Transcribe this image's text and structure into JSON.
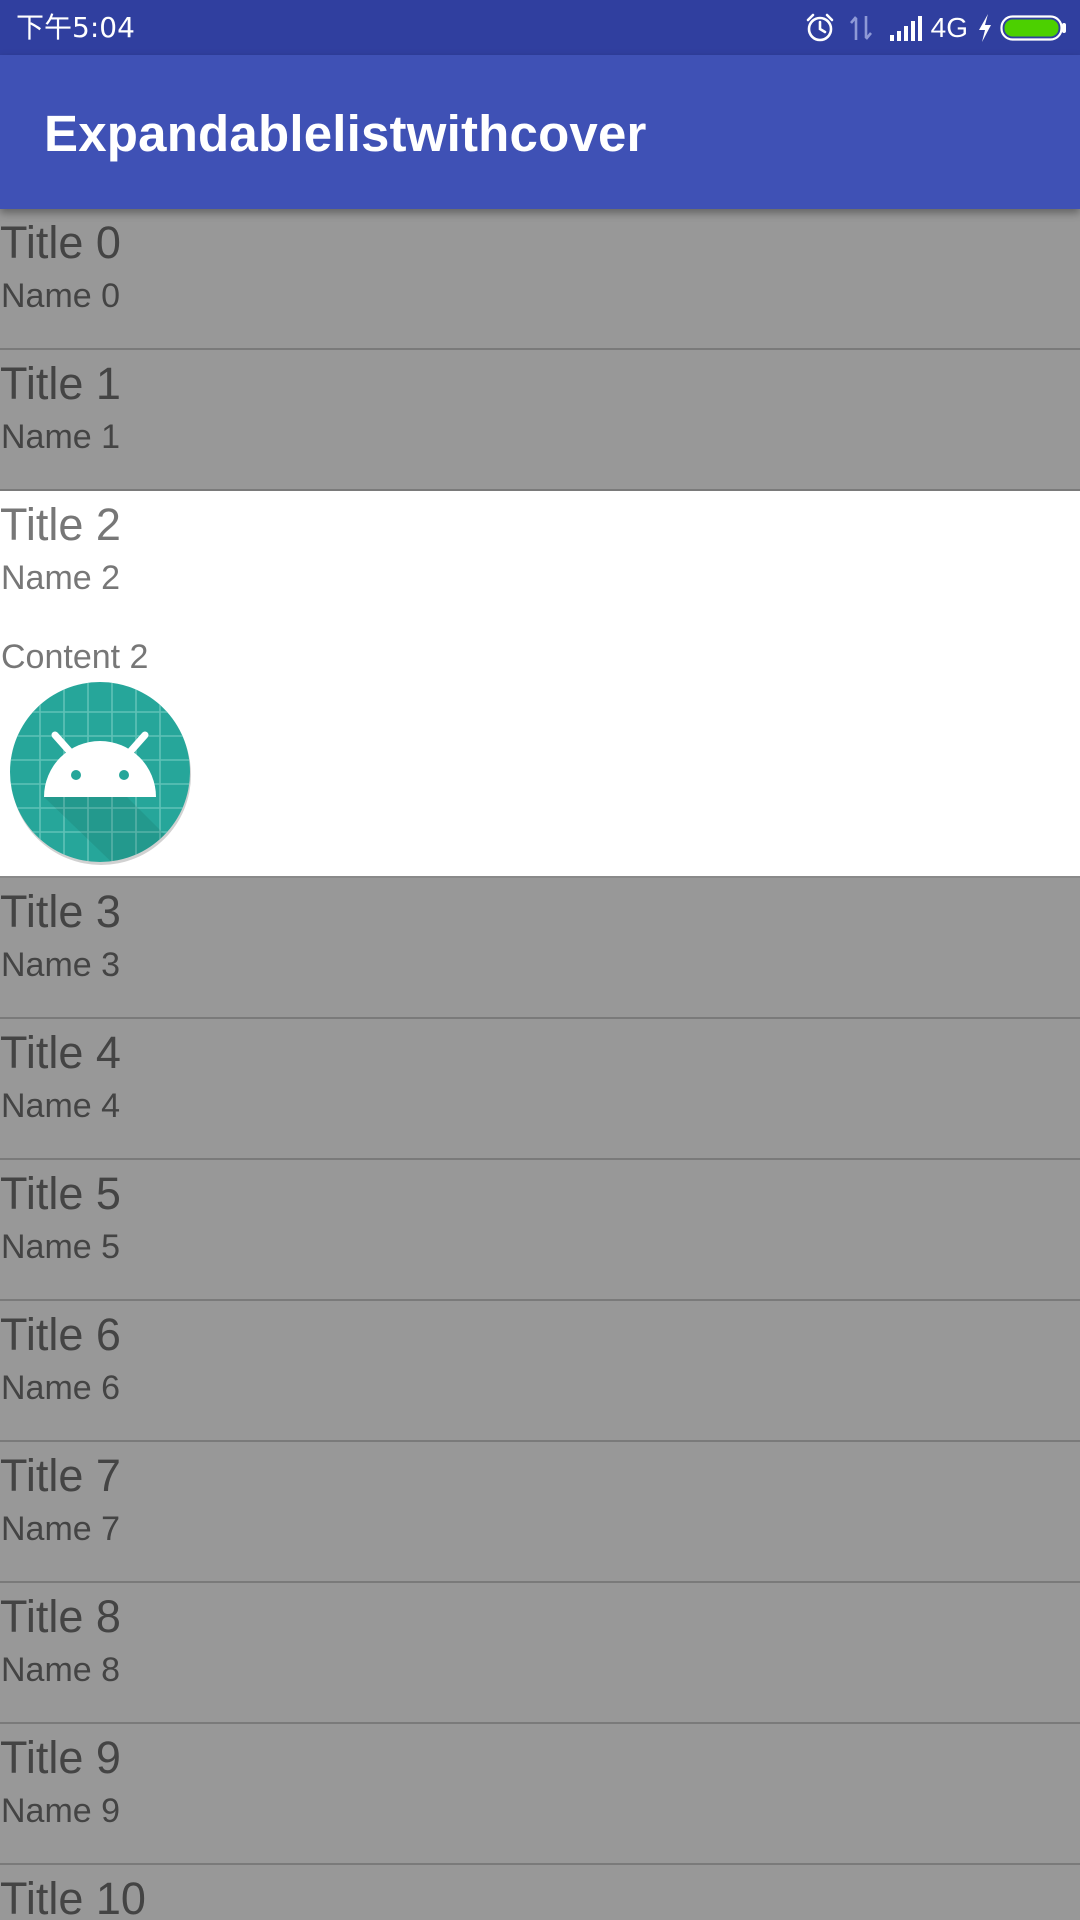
{
  "status_bar": {
    "time": "下午5:04",
    "network": "4G",
    "icons": [
      "alarm-icon",
      "data-arrows-icon",
      "signal-icon",
      "charging-icon",
      "battery-icon"
    ],
    "battery_color": "#4cd000"
  },
  "app_bar": {
    "title": "Expandablelistwithcover",
    "color": "#3f51b5"
  },
  "list": {
    "groups": [
      {
        "title": "Title 0",
        "name": "Name 0"
      },
      {
        "title": "Title 1",
        "name": "Name 1"
      },
      {
        "title": "Title 2",
        "name": "Name 2",
        "expanded": true,
        "child": {
          "content": "Content 2",
          "image": "android-launcher-icon"
        }
      },
      {
        "title": "Title 3",
        "name": "Name 3"
      },
      {
        "title": "Title 4",
        "name": "Name 4"
      },
      {
        "title": "Title 5",
        "name": "Name 5"
      },
      {
        "title": "Title 6",
        "name": "Name 6"
      },
      {
        "title": "Title 7",
        "name": "Name 7"
      },
      {
        "title": "Title 8",
        "name": "Name 8"
      },
      {
        "title": "Title 9",
        "name": "Name 9"
      },
      {
        "title": "Title 10",
        "name": ""
      }
    ],
    "cover_color": "#989898",
    "expanded_color": "#ffffff"
  }
}
